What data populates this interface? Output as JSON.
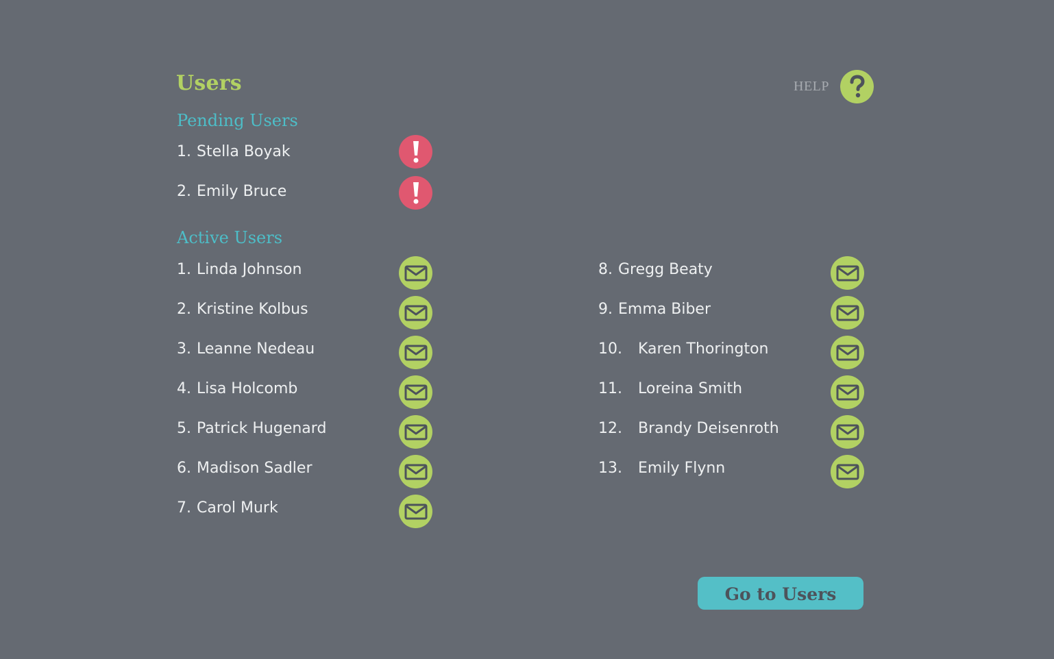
{
  "header": {
    "title": "Users",
    "help_label": "HELP",
    "help_icon": "question-mark-icon"
  },
  "colors": {
    "background": "#656a72",
    "accent_green": "#b2d163",
    "accent_teal": "#4dbec8",
    "alert_red": "#e05870",
    "text_light": "#eef0f1"
  },
  "pending": {
    "heading": "Pending Users",
    "icon": "alert-exclamation-icon",
    "users": [
      {
        "num": "1.",
        "name": "Stella Boyak"
      },
      {
        "num": "2.",
        "name": "Emily Bruce"
      }
    ]
  },
  "active": {
    "heading": "Active Users",
    "icon": "mail-envelope-icon",
    "users": [
      {
        "num": "1.",
        "name": "Linda Johnson"
      },
      {
        "num": "2.",
        "name": "Kristine Kolbus"
      },
      {
        "num": "3.",
        "name": "Leanne Nedeau"
      },
      {
        "num": "4.",
        "name": "Lisa Holcomb"
      },
      {
        "num": "5.",
        "name": "Patrick Hugenard"
      },
      {
        "num": "6.",
        "name": "Madison Sadler"
      },
      {
        "num": "7.",
        "name": "Carol Murk"
      },
      {
        "num": "8.",
        "name": "Gregg Beaty"
      },
      {
        "num": "9.",
        "name": "Emma Biber"
      },
      {
        "num": "10.",
        "name": "Karen Thorington"
      },
      {
        "num": "11.",
        "name": "Loreina Smith"
      },
      {
        "num": "12.",
        "name": "Brandy Deisenroth"
      },
      {
        "num": "13.",
        "name": "Emily Flynn"
      }
    ]
  },
  "footer": {
    "go_button_label": "Go to Users"
  }
}
